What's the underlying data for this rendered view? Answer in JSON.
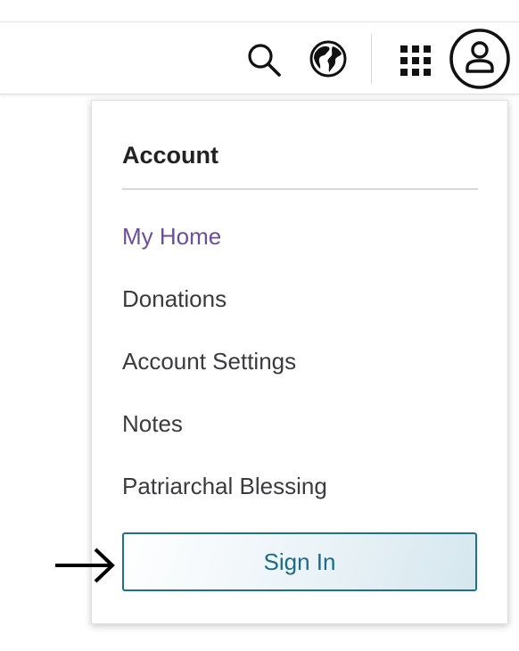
{
  "header": {
    "icons": [
      "search-icon",
      "globe-icon",
      "apps-grid-icon",
      "account-icon"
    ]
  },
  "account_menu": {
    "title": "Account",
    "items": [
      {
        "label": "My Home",
        "active": true
      },
      {
        "label": "Donations"
      },
      {
        "label": "Account Settings"
      },
      {
        "label": "Notes"
      },
      {
        "label": "Patriarchal Blessing"
      }
    ],
    "sign_in_label": "Sign In"
  },
  "colors": {
    "active_link": "#6b4f9a",
    "sign_in_border": "#1f6f8f",
    "sign_in_text": "#1c6b8c"
  }
}
